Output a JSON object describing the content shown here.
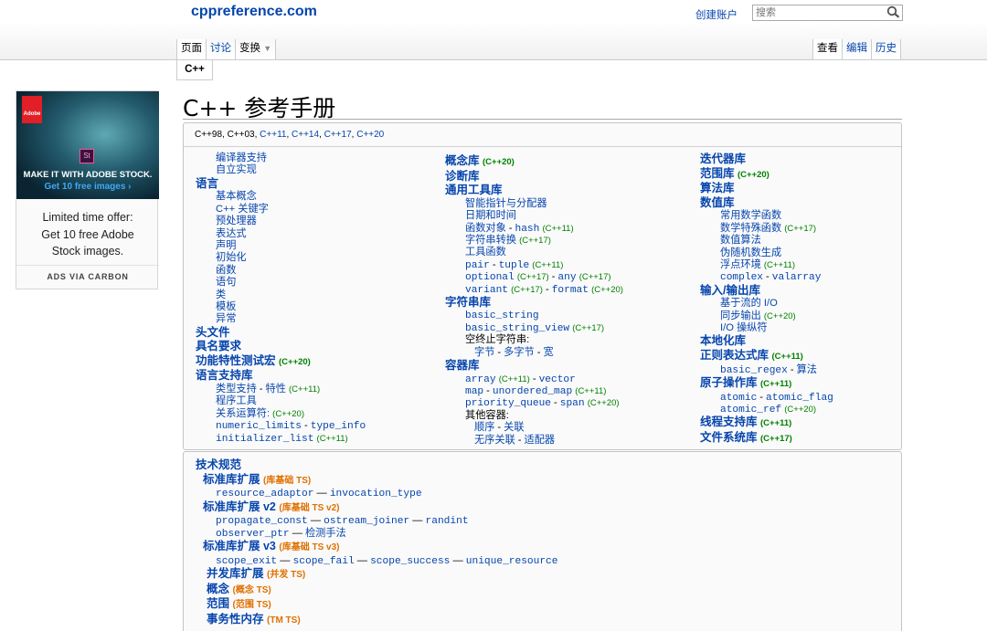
{
  "site": {
    "logo": "cppreference.com",
    "create_account": "创建账户",
    "search_placeholder": "搜索"
  },
  "tabs": {
    "page": "页面",
    "discussion": "讨论",
    "variants": "变换",
    "view": "查看",
    "edit": "编辑",
    "history": "历史",
    "namespace": "C++"
  },
  "ad": {
    "brand": "Adobe",
    "st": "St",
    "headline": "MAKE IT WITH ADOBE STOCK.",
    "cta": "Get 10 free images ›",
    "text_lines": [
      "Limited time offer:",
      "Get 10 free Adobe",
      "Stock images."
    ],
    "via": "ADS VIA CARBON"
  },
  "page_title": "C++ 参考手册",
  "standards": {
    "plain": "C++98, C++03, ",
    "links": [
      "C++11",
      "C++14",
      "C++17",
      "C++20"
    ]
  },
  "col1": [
    {
      "t": "编译器支持",
      "c": "i1"
    },
    {
      "t": "自立实现",
      "c": "i1"
    },
    {
      "t": "语言",
      "c": "h"
    },
    {
      "t": "基本概念",
      "c": "i1"
    },
    {
      "t": "C++ 关键字",
      "c": "i1"
    },
    {
      "t": "预处理器",
      "c": "i1"
    },
    {
      "t": "表达式",
      "c": "i1"
    },
    {
      "t": "声明",
      "c": "i1"
    },
    {
      "t": "初始化",
      "c": "i1"
    },
    {
      "t": "函数",
      "c": "i1"
    },
    {
      "t": "语句",
      "c": "i1"
    },
    {
      "t": "类",
      "c": "i1"
    },
    {
      "t": "模板",
      "c": "i1"
    },
    {
      "t": "异常",
      "c": "i1"
    },
    {
      "t": "头文件",
      "c": "h"
    },
    {
      "t": "具名要求",
      "c": "h"
    },
    {
      "t": "功能特性测试宏",
      "c": "h",
      "v": "(C++20)"
    },
    {
      "t": "语言支持库",
      "c": "h"
    }
  ],
  "col1b": {
    "type_support": "类型支持",
    "traits": "特性",
    "traits_v": "(C++11)",
    "program_utils": "程序工具",
    "relational_ops": "关系运算符:",
    "relational_v": "(C++20)",
    "numeric_limits": "numeric_limits",
    "type_info": "type_info",
    "initializer_list": "initializer_list",
    "initializer_v": "(C++11)"
  },
  "col2": {
    "concepts": "概念库",
    "concepts_v": "(C++20)",
    "diagnostics": "诊断库",
    "utilities": "通用工具库",
    "smart_ptr": "智能指针与分配器",
    "datetime": "日期和时间",
    "function_obj": "函数对象",
    "hash": "hash",
    "hash_v": "(C++11)",
    "string_conv": "字符串转换",
    "string_conv_v": "(C++17)",
    "util_funcs": "工具函数",
    "pair": "pair",
    "tuple": "tuple",
    "tuple_v": "(C++11)",
    "optional": "optional",
    "optional_v": "(C++17)",
    "any": "any",
    "any_v": "(C++17)",
    "variant": "variant",
    "variant_v": "(C++17)",
    "format": "format",
    "format_v": "(C++20)",
    "strings": "字符串库",
    "basic_string": "basic_string",
    "basic_string_view": "basic_string_view",
    "bsv_v": "(C++17)",
    "null_term": "空终止字符串:",
    "byte": "字节",
    "multibyte": "多字节",
    "wide": "宽",
    "containers": "容器库",
    "array": "array",
    "array_v": "(C++11)",
    "vector": "vector",
    "map": "map",
    "unordered_map": "unordered_map",
    "umap_v": "(C++11)",
    "priority_queue": "priority_queue",
    "span": "span",
    "span_v": "(C++20)",
    "other_containers": "其他容器:",
    "sequence": "顺序",
    "associative": "关联",
    "unordered_assoc": "无序关联",
    "adaptors": "适配器"
  },
  "col3": {
    "iterators": "迭代器库",
    "ranges": "范围库",
    "ranges_v": "(C++20)",
    "algorithms": "算法库",
    "numerics": "数值库",
    "common_math": "常用数学函数",
    "special_math": "数学特殊函数",
    "special_v": "(C++17)",
    "numeric_algo": "数值算法",
    "prng": "伪随机数生成",
    "fenv": "浮点环境",
    "fenv_v": "(C++11)",
    "complex": "complex",
    "valarray": "valarray",
    "io": "输入/输出库",
    "stream_io": "基于流的 I/O",
    "sync_out": "同步输出",
    "sync_v": "(C++20)",
    "io_manip": "I/O 操纵符",
    "localization": "本地化库",
    "regex": "正则表达式库",
    "regex_v": "(C++11)",
    "basic_regex": "basic_regex",
    "regex_algo": "算法",
    "atomic_ops": "原子操作库",
    "atomic_v": "(C++11)",
    "atomic": "atomic",
    "atomic_flag": "atomic_flag",
    "atomic_ref": "atomic_ref",
    "atomic_ref_v": "(C++20)",
    "thread": "线程支持库",
    "thread_v": "(C++11)",
    "filesystem": "文件系统库",
    "fs_v": "(C++17)"
  },
  "ts": {
    "title": "技术规范",
    "libext": "标准库扩展",
    "libext_tag": "(库基础 TS)",
    "resource_adaptor": "resource_adaptor",
    "invocation_type": "invocation_type",
    "libext2": "标准库扩展 v2",
    "libext2_tag": "(库基础 TS v2)",
    "propagate_const": "propagate_const",
    "ostream_joiner": "ostream_joiner",
    "randint": "randint",
    "observer_ptr": "observer_ptr",
    "detection": "检测手法",
    "libext3": "标准库扩展 v3",
    "libext3_tag": "(库基础 TS v3)",
    "scope_exit": "scope_exit",
    "scope_fail": "scope_fail",
    "scope_success": "scope_success",
    "unique_resource": "unique_resource",
    "concurrency": "并发库扩展",
    "concurrency_tag": "(并发 TS)",
    "concepts": "概念",
    "concepts_tag": "(概念 TS)",
    "ranges": "范围",
    "ranges_tag": "(范围 TS)",
    "tm": "事务性内存",
    "tm_tag": "(TM TS)",
    "dash": "—"
  }
}
